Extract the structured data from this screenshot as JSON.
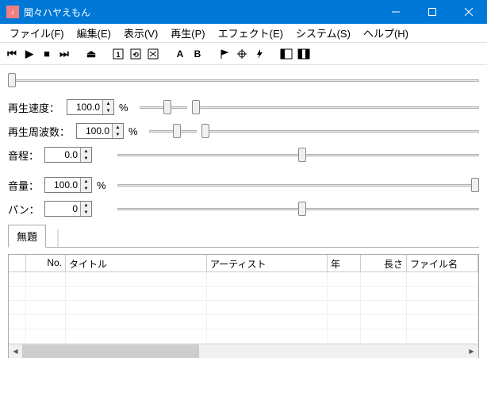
{
  "title": "聞々ハヤえもん",
  "menu": {
    "file": "ファイル(F)",
    "edit": "編集(E)",
    "view": "表示(V)",
    "play": "再生(P)",
    "effect": "エフェクト(E)",
    "system": "システム(S)",
    "help": "ヘルプ(H)"
  },
  "toolbar_letters": {
    "a": "A",
    "b": "B"
  },
  "params": {
    "speed_label": "再生速度：",
    "speed_value": "100.0",
    "freq_label": "再生周波数：",
    "freq_value": "100.0",
    "pitch_label": "音程：",
    "pitch_value": "0.0",
    "volume_label": "音量：",
    "volume_value": "100.0",
    "pan_label": "パン：",
    "pan_value": "0",
    "percent": "%"
  },
  "tab": {
    "label": "無題"
  },
  "grid": {
    "cols": {
      "no": "No.",
      "title": "タイトル",
      "artist": "アーティスト",
      "year": "年",
      "length": "長さ",
      "file": "ファイル名"
    }
  }
}
